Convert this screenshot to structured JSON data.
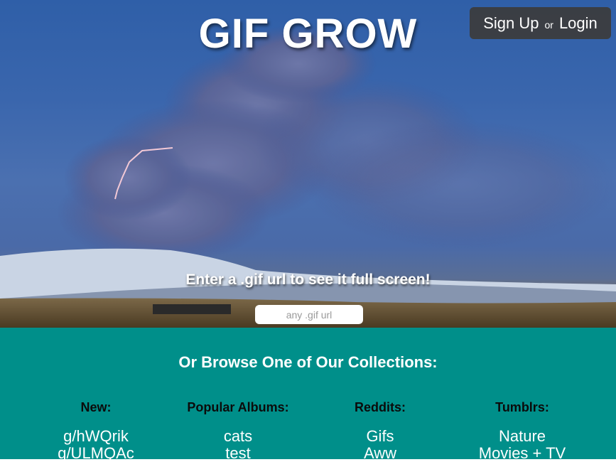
{
  "header": {
    "title": "GIF GROW",
    "signup_label": "Sign Up",
    "or_label": "or",
    "login_label": "Login"
  },
  "hero": {
    "tagline": "Enter a .gif url to see it full screen!",
    "input_placeholder": "any .gif url",
    "input_value": ""
  },
  "browse": {
    "title": "Or Browse One of Our Collections:",
    "columns": [
      {
        "heading": "New:",
        "items": [
          "g/hWQrik",
          "g/ULMQAc"
        ]
      },
      {
        "heading": "Popular Albums:",
        "items": [
          "cats",
          "test"
        ]
      },
      {
        "heading": "Reddits:",
        "items": [
          "Gifs",
          "Aww"
        ]
      },
      {
        "heading": "Tumblrs:",
        "items": [
          "Nature",
          "Movies + TV"
        ]
      }
    ]
  },
  "colors": {
    "browse_bg": "#008f8a",
    "auth_bg": "#3c3c3c",
    "sky": "#3a66ad"
  }
}
